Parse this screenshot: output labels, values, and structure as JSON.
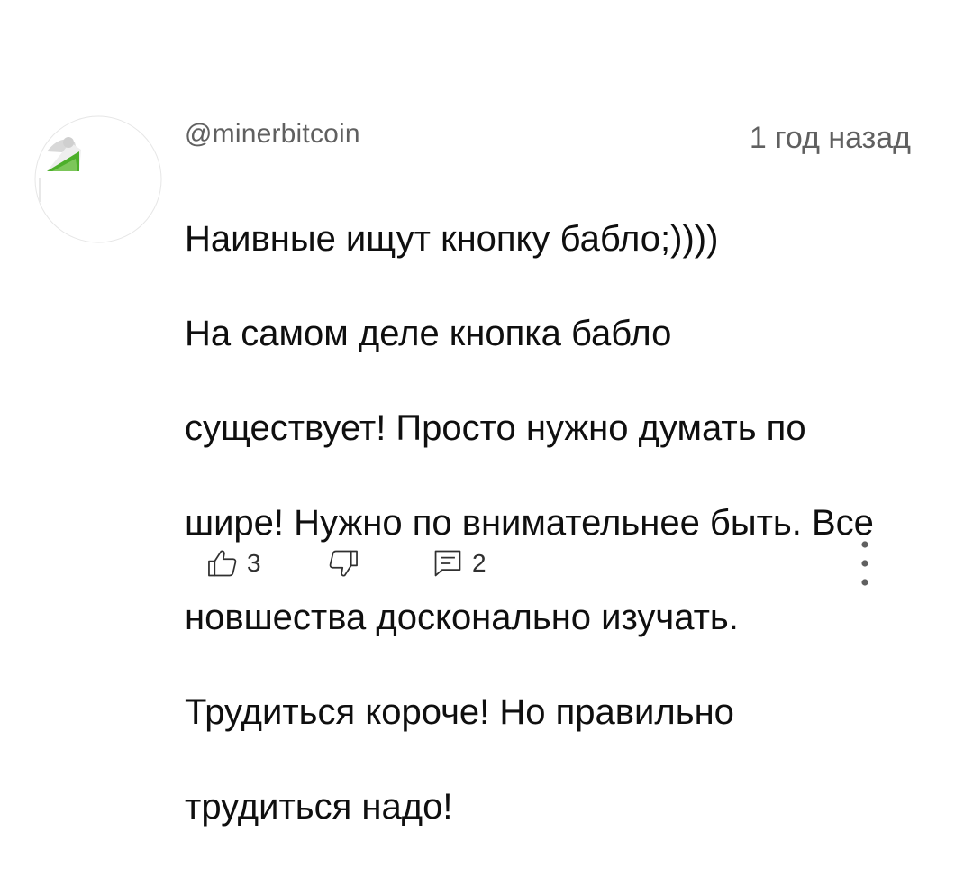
{
  "comment": {
    "author": "@minerbitcoin",
    "time": "1 год назад",
    "lines": [
      "Наивные ищут кнопку бабло;))))",
      "На самом деле кнопка бабло",
      "существует! Просто нужно думать по",
      "шире! Нужно по внимательнее быть. Все",
      "новшества досконально изучать.",
      "Трудиться короче! Но правильно",
      "трудиться надо!"
    ]
  },
  "actions": {
    "like_count": "3",
    "reply_count": "2"
  },
  "icons": {
    "like": "thumbs-up-icon",
    "dislike": "thumbs-down-icon",
    "reply": "comment-icon",
    "more": "more-vertical-icon"
  }
}
